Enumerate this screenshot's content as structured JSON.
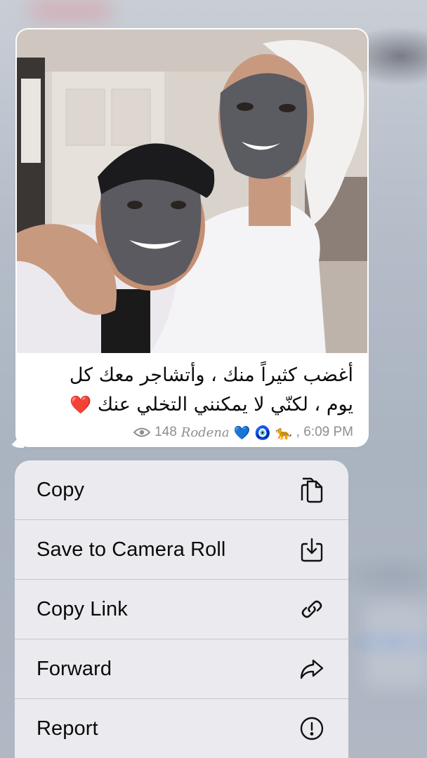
{
  "message": {
    "caption_line1": "أغضب كثيراً منك ، وأتشاجر معك كل",
    "caption_line2": "يوم ، لكنّي لا يمكنني التخلي عنك",
    "caption_heart": "❤️",
    "views": "148",
    "author": "Rodena",
    "author_emojis": [
      "💙",
      "🧿",
      "🐆"
    ],
    "time": ", 6:09 PM",
    "photo_alt": "selfie of two people wearing charcoal face masks"
  },
  "menu": {
    "items": [
      {
        "label": "Copy",
        "icon": "copy-icon"
      },
      {
        "label": "Save to Camera Roll",
        "icon": "save-download-icon"
      },
      {
        "label": "Copy Link",
        "icon": "link-icon"
      },
      {
        "label": "Forward",
        "icon": "forward-arrow-icon"
      },
      {
        "label": "Report",
        "icon": "exclamation-circle-icon"
      }
    ]
  },
  "colors": {
    "bubble": "#ffffff",
    "menu_bg": "#edeef0",
    "meta_text": "#8e8e93",
    "heart": "#d0141c"
  }
}
